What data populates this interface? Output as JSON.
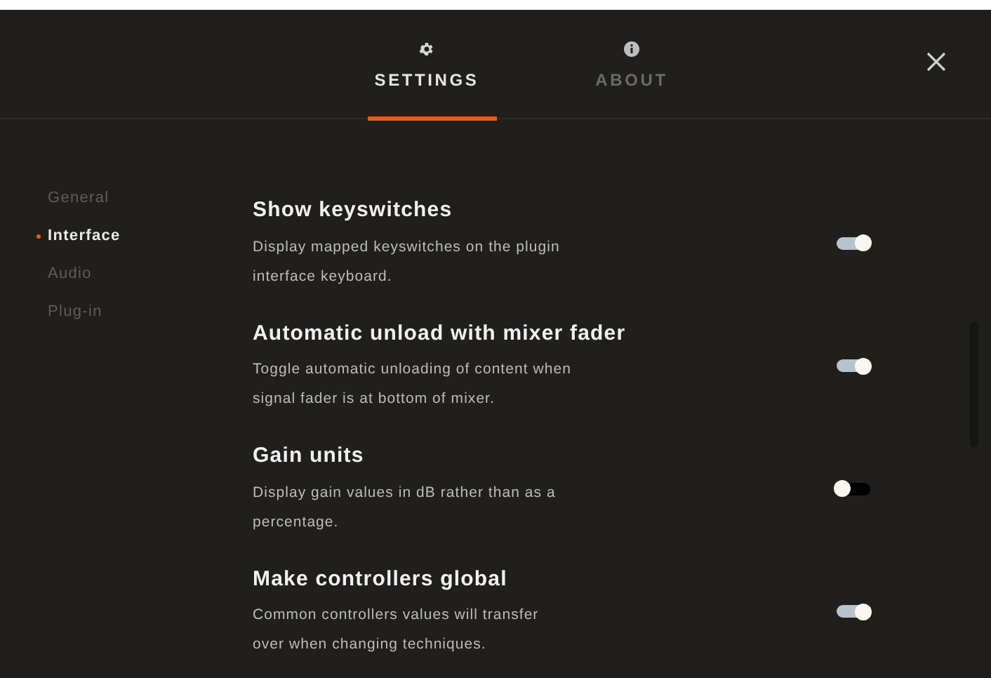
{
  "tabs": [
    {
      "label": "SETTINGS",
      "selected": true
    },
    {
      "label": "ABOUT",
      "selected": false
    }
  ],
  "sidebar": {
    "items": [
      {
        "label": "General",
        "selected": false
      },
      {
        "label": "Interface",
        "selected": true
      },
      {
        "label": "Audio",
        "selected": false
      },
      {
        "label": "Plug-in",
        "selected": false
      }
    ]
  },
  "settings": [
    {
      "title": "Show keyswitches",
      "description": "Display mapped keyswitches on the plugin interface keyboard.",
      "on": true
    },
    {
      "title": "Automatic unload with mixer fader",
      "description": "Toggle automatic unloading of content when signal fader is at bottom of mixer.",
      "on": true
    },
    {
      "title": "Gain units",
      "description": "Display gain values in dB rather than as a percentage.",
      "on": false
    },
    {
      "title": "Make controllers global",
      "description": "Common controllers values will transfer over when changing techniques.",
      "on": true
    }
  ]
}
